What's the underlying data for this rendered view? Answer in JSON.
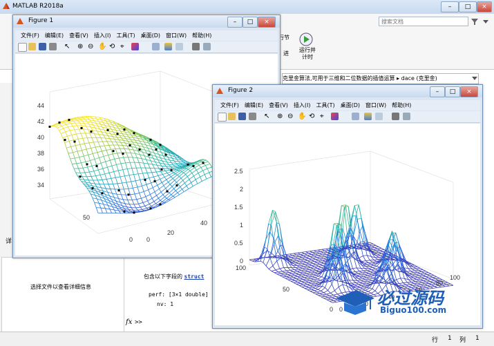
{
  "app": {
    "title": "MATLAB R2018a",
    "search_placeholder": "搜索文档",
    "ribbon_labels": [
      "行节",
      "运行并\n计时",
      "进"
    ],
    "breadcrumb": [
      "克里金算法,可用于三维和二位数据的插值运算",
      "dace (克里金)"
    ],
    "left_panel": {
      "side_label": "详",
      "details_text": "选择文件以查看详细信息"
    },
    "command_window": {
      "intro_text": "包含以下字段的",
      "struct_link": "struct",
      "perf_line": "perf: [3×1 double]",
      "nv_line": "nv: 1",
      "fx_symbol": "fx",
      "prompt": ">>"
    },
    "status": {
      "row_label": "行",
      "row_value": "1",
      "col_label": "列",
      "col_value": "1"
    },
    "watermark": {
      "cn": "必过源码",
      "en": "Biguo100.com"
    }
  },
  "figure1": {
    "title": "Figure 1",
    "menu": [
      "文件(F)",
      "编辑(E)",
      "查看(V)",
      "插入(I)",
      "工具(T)",
      "桌面(D)",
      "窗口(W)",
      "帮助(H)"
    ],
    "z_ticks": [
      "44",
      "42",
      "40",
      "38",
      "36",
      "34"
    ],
    "y_ticks": [
      "50",
      "0"
    ],
    "x_ticks": [
      "0",
      "20",
      "40"
    ]
  },
  "figure2": {
    "title": "Figure 2",
    "menu": [
      "文件(F)",
      "编辑(E)",
      "查看(V)",
      "插入(I)",
      "工具(T)",
      "桌面(D)",
      "窗口(W)",
      "帮助(H)"
    ],
    "z_ticks": [
      "2.5",
      "2",
      "1.5",
      "1",
      "0.5",
      "0"
    ],
    "y_ticks": [
      "100",
      "50",
      "0"
    ],
    "x_ticks": [
      "0",
      "20",
      "40",
      "60",
      "80",
      "100"
    ]
  },
  "colors": {
    "accent": "#2c5ea8",
    "surface_high": "#f5e11d",
    "surface_mid": "#3db5a0",
    "surface_low": "#4b2c9b"
  },
  "chart_data": [
    {
      "type": "surface",
      "title": "",
      "z_ticks": [
        44,
        42,
        40,
        38,
        36,
        34
      ],
      "y_ticks": [
        50,
        0
      ],
      "x_ticks": [
        0,
        20,
        40
      ],
      "colormap": "parula",
      "has_scatter_points": true
    },
    {
      "type": "surface",
      "title": "",
      "z_ticks": [
        2.5,
        2,
        1.5,
        1,
        0.5,
        0
      ],
      "y_ticks": [
        100,
        50,
        0
      ],
      "x_ticks": [
        0,
        20,
        40,
        60,
        80,
        100
      ],
      "colormap": "parula",
      "has_scatter_points": false
    }
  ]
}
